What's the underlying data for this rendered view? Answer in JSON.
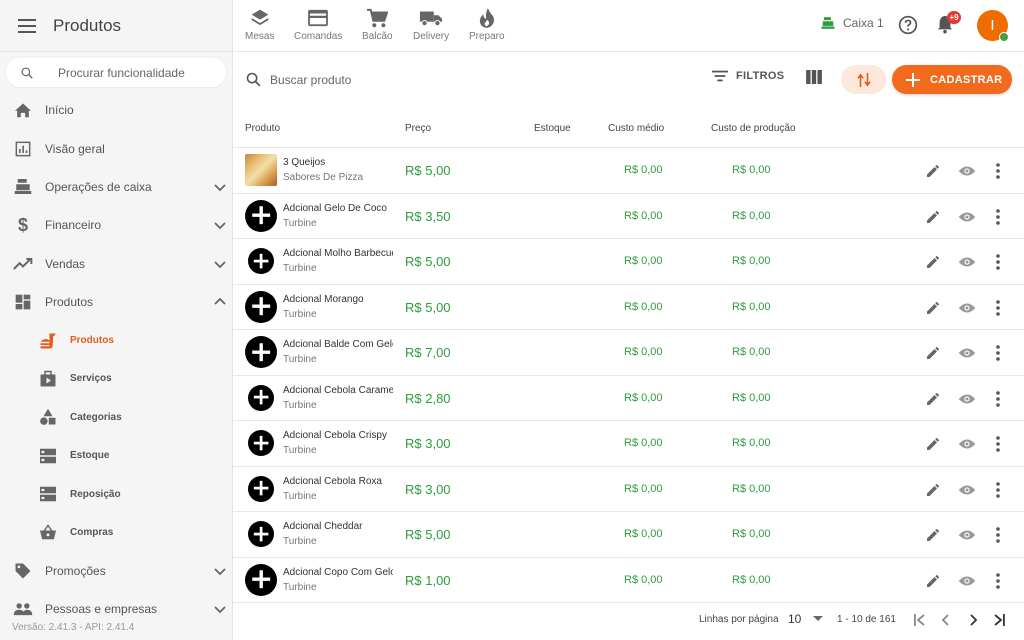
{
  "app": {
    "title": "Produtos"
  },
  "sidebar": {
    "search_placeholder": "Procurar funcionalidade",
    "items": [
      {
        "label": "Início",
        "icon": "home-icon"
      },
      {
        "label": "Visão geral",
        "icon": "bar-chart-icon"
      },
      {
        "label": "Operações de caixa",
        "icon": "cash-register-icon"
      },
      {
        "label": "Financeiro",
        "icon": "dollar-icon"
      },
      {
        "label": "Vendas",
        "icon": "trending-up-icon"
      },
      {
        "label": "Produtos",
        "icon": "dashboard-icon"
      }
    ],
    "sub_items": [
      {
        "label": "Produtos",
        "icon": "fastfood-icon",
        "active": true
      },
      {
        "label": "Serviços",
        "icon": "services-icon"
      },
      {
        "label": "Categorias",
        "icon": "category-icon"
      },
      {
        "label": "Estoque",
        "icon": "storage-icon"
      },
      {
        "label": "Reposição",
        "icon": "storage-icon"
      },
      {
        "label": "Compras",
        "icon": "basket-icon"
      }
    ],
    "bottom_items": [
      {
        "label": "Promoções",
        "icon": "tag-icon"
      },
      {
        "label": "Pessoas e empresas",
        "icon": "people-icon"
      }
    ],
    "version": "Versão: 2.41.3 - API: 2.41.4"
  },
  "topbar": {
    "modes": [
      {
        "label": "Mesas",
        "icon": "layers-icon"
      },
      {
        "label": "Comandas",
        "icon": "credit-card-icon"
      },
      {
        "label": "Balcão",
        "icon": "cart-icon"
      },
      {
        "label": "Delivery",
        "icon": "truck-icon"
      },
      {
        "label": "Preparo",
        "icon": "flame-icon"
      }
    ],
    "caixa_label": "Caixa 1",
    "notification_badge": "+9",
    "avatar_initial": "I"
  },
  "toolbar": {
    "search_placeholder": "Buscar produto",
    "filter_label": "FILTROS",
    "create_label": "CADASTRAR"
  },
  "table": {
    "headers": {
      "product": "Produto",
      "price": "Preço",
      "stock": "Estoque",
      "avg_cost": "Custo médio",
      "prod_cost": "Custo de produção"
    },
    "rows": [
      {
        "name": "3 Queijos",
        "category": "Sabores De Pizza",
        "price": "R$ 5,00",
        "avg_cost": "R$ 0,00",
        "prod_cost": "R$ 0,00",
        "thumb": "pizza"
      },
      {
        "name": "Adcional Gelo De Coco",
        "category": "Turbine",
        "price": "R$ 3,50",
        "avg_cost": "R$ 0,00",
        "prod_cost": "R$ 0,00",
        "thumb": "plus"
      },
      {
        "name": "Adcional Molho Barbecue",
        "category": "Turbine",
        "price": "R$ 5,00",
        "avg_cost": "R$ 0,00",
        "prod_cost": "R$ 0,00",
        "thumb": "plus-small"
      },
      {
        "name": "Adcional Morango",
        "category": "Turbine",
        "price": "R$ 5,00",
        "avg_cost": "R$ 0,00",
        "prod_cost": "R$ 0,00",
        "thumb": "plus"
      },
      {
        "name": "Adcional Balde Com Gelo",
        "category": "Turbine",
        "price": "R$ 7,00",
        "avg_cost": "R$ 0,00",
        "prod_cost": "R$ 0,00",
        "thumb": "plus"
      },
      {
        "name": "Adcional Cebola Caramelizada",
        "category": "Turbine",
        "price": "R$ 2,80",
        "avg_cost": "R$ 0,00",
        "prod_cost": "R$ 0,00",
        "thumb": "plus-small"
      },
      {
        "name": "Adcional Cebola Crispy",
        "category": "Turbine",
        "price": "R$ 3,00",
        "avg_cost": "R$ 0,00",
        "prod_cost": "R$ 0,00",
        "thumb": "plus-small"
      },
      {
        "name": "Adcional Cebola Roxa",
        "category": "Turbine",
        "price": "R$ 3,00",
        "avg_cost": "R$ 0,00",
        "prod_cost": "R$ 0,00",
        "thumb": "plus-small"
      },
      {
        "name": "Adcional Cheddar",
        "category": "Turbine",
        "price": "R$ 5,00",
        "avg_cost": "R$ 0,00",
        "prod_cost": "R$ 0,00",
        "thumb": "plus-small"
      },
      {
        "name": "Adcional Copo Com Gelo",
        "category": "Turbine",
        "price": "R$ 1,00",
        "avg_cost": "R$ 0,00",
        "prod_cost": "R$ 0,00",
        "thumb": "plus"
      }
    ]
  },
  "pagination": {
    "rows_per_page_label": "Linhas por página",
    "rows_per_page_value": "10",
    "range": "1 - 10 de 161"
  },
  "colors": {
    "accent": "#f26a1b",
    "price_green": "#2e9d3c",
    "badge_red": "#e53935",
    "online_green": "#43a047"
  }
}
